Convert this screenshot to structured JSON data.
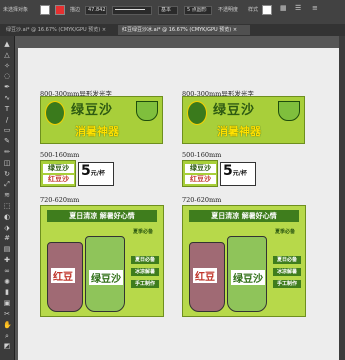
{
  "control_bar": {
    "selection_label": "未选择对象",
    "stroke_label": "描边",
    "stroke_value": "",
    "brush_value": "基本",
    "opacity_label": "不透明度",
    "style_label": "样式",
    "size_value": "47.842",
    "point_value": "5 点圆形",
    "colors": {
      "fill": "#ffffff",
      "stroke": "#e53030"
    }
  },
  "tabs": [
    {
      "label": "绿豆沙.ai* @ 16.67% (CMYK/GPU 预览)"
    },
    {
      "label": "红豆绿豆沙冰.ai* @ 16.67% (CMYK/GPU 预览)"
    }
  ],
  "tools": [
    "selection-icon",
    "direct-selection-icon",
    "magic-wand-icon",
    "lasso-icon",
    "pen-icon",
    "curvature-icon",
    "type-icon",
    "line-icon",
    "rectangle-icon",
    "paintbrush-icon",
    "pencil-icon",
    "eraser-icon",
    "rotate-icon",
    "scale-icon",
    "width-icon",
    "free-transform-icon",
    "shape-builder-icon",
    "perspective-icon",
    "mesh-icon",
    "gradient-icon",
    "eyedropper-icon",
    "blend-icon",
    "symbol-sprayer-icon",
    "graph-icon",
    "artboard-icon",
    "slice-icon",
    "hand-icon",
    "zoom-icon",
    "fill-stroke-icon"
  ],
  "artboards": {
    "label_banner": "800-300mm异形发光字",
    "label_small": "500-160mm",
    "label_poster": "720-620mm",
    "banner_title": "绿豆沙",
    "banner_subtitle": "消暑神器",
    "chip_top": "绿豆沙",
    "chip_bottom": "红豆沙",
    "price": "5",
    "price_unit": "元/杯",
    "poster_title": "夏日清凉 解暑好心情",
    "cup_red": "红豆",
    "cup_green": "绿豆沙",
    "corner_badge": "夏季必备",
    "tags": [
      "夏日必备",
      "冰凉解暑",
      "手工制作"
    ]
  }
}
